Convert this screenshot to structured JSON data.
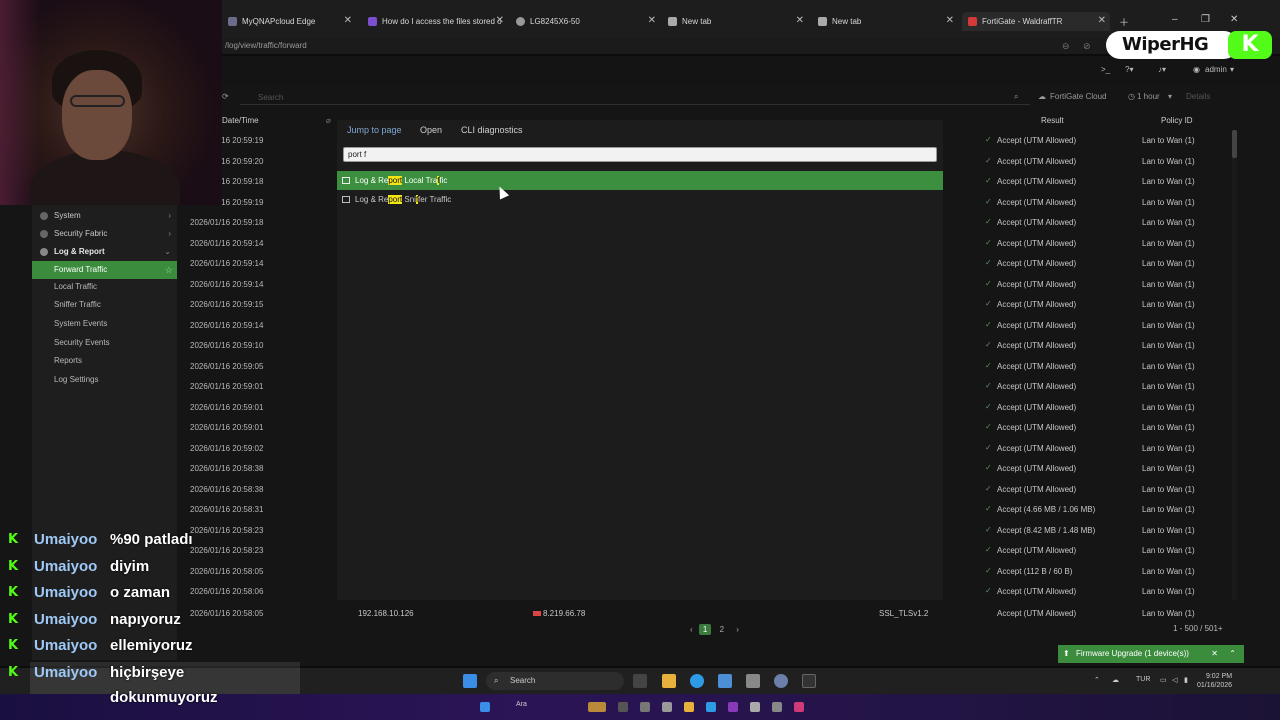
{
  "browser": {
    "tabs": [
      {
        "label": "MyQNAPcloud Edge"
      },
      {
        "label": "How do I access the files stored o"
      },
      {
        "label": "LG8245X6-50"
      },
      {
        "label": "New tab"
      },
      {
        "label": "New tab"
      },
      {
        "label": "FortiGate - WaldraffTR"
      }
    ],
    "url": "/log/view/traffic/forward"
  },
  "app": {
    "admin_label": "admin",
    "search_placeholder": "Search",
    "scope": "FortiGate Cloud",
    "time_range": "1 hour",
    "details": "Details"
  },
  "sidebar": {
    "items": [
      {
        "label": "System"
      },
      {
        "label": "Security Fabric"
      },
      {
        "label": "Log & Report"
      },
      {
        "label": "Forward Traffic"
      },
      {
        "label": "Local Traffic"
      },
      {
        "label": "Sniffer Traffic"
      },
      {
        "label": "System Events"
      },
      {
        "label": "Security Events"
      },
      {
        "label": "Reports"
      },
      {
        "label": "Log Settings"
      }
    ]
  },
  "table": {
    "headers": {
      "date": "Date/Time",
      "result": "Result",
      "policy": "Policy ID"
    },
    "rows": [
      {
        "date": "2026/01/16 20:59:19",
        "result": "Accept (UTM Allowed)",
        "policy": "Lan to Wan (1)"
      },
      {
        "date": "2026/01/16 20:59:20",
        "result": "Accept (UTM Allowed)",
        "policy": "Lan to Wan (1)"
      },
      {
        "date": "2026/01/16 20:59:18",
        "result": "Accept (UTM Allowed)",
        "policy": "Lan to Wan (1)"
      },
      {
        "date": "2026/01/16 20:59:19",
        "result": "Accept (UTM Allowed)",
        "policy": "Lan to Wan (1)"
      },
      {
        "date": "2026/01/16 20:59:18",
        "result": "Accept (UTM Allowed)",
        "policy": "Lan to Wan (1)"
      },
      {
        "date": "2026/01/16 20:59:14",
        "result": "Accept (UTM Allowed)",
        "policy": "Lan to Wan (1)"
      },
      {
        "date": "2026/01/16 20:59:14",
        "result": "Accept (UTM Allowed)",
        "policy": "Lan to Wan (1)"
      },
      {
        "date": "2026/01/16 20:59:14",
        "result": "Accept (UTM Allowed)",
        "policy": "Lan to Wan (1)"
      },
      {
        "date": "2026/01/16 20:59:15",
        "result": "Accept (UTM Allowed)",
        "policy": "Lan to Wan (1)"
      },
      {
        "date": "2026/01/16 20:59:14",
        "result": "Accept (UTM Allowed)",
        "policy": "Lan to Wan (1)"
      },
      {
        "date": "2026/01/16 20:59:10",
        "result": "Accept (UTM Allowed)",
        "policy": "Lan to Wan (1)"
      },
      {
        "date": "2026/01/16 20:59:05",
        "result": "Accept (UTM Allowed)",
        "policy": "Lan to Wan (1)"
      },
      {
        "date": "2026/01/16 20:59:01",
        "result": "Accept (UTM Allowed)",
        "policy": "Lan to Wan (1)"
      },
      {
        "date": "2026/01/16 20:59:01",
        "result": "Accept (UTM Allowed)",
        "policy": "Lan to Wan (1)"
      },
      {
        "date": "2026/01/16 20:59:01",
        "result": "Accept (UTM Allowed)",
        "policy": "Lan to Wan (1)"
      },
      {
        "date": "2026/01/16 20:59:02",
        "result": "Accept (UTM Allowed)",
        "policy": "Lan to Wan (1)"
      },
      {
        "date": "2026/01/16 20:58:38",
        "result": "Accept (UTM Allowed)",
        "policy": "Lan to Wan (1)"
      },
      {
        "date": "2026/01/16 20:58:38",
        "result": "Accept (UTM Allowed)",
        "policy": "Lan to Wan (1)"
      },
      {
        "date": "2026/01/16 20:58:31",
        "result": "Accept (4.66 MB / 1.06 MB)",
        "policy": "Lan to Wan (1)"
      },
      {
        "date": "2026/01/16 20:58:23",
        "result": "Accept (8.42 MB / 1.48 MB)",
        "policy": "Lan to Wan (1)"
      },
      {
        "date": "2026/01/16 20:58:23",
        "result": "Accept (UTM Allowed)",
        "policy": "Lan to Wan (1)"
      },
      {
        "date": "2026/01/16 20:58:05",
        "result": "Accept (112 B / 60 B)",
        "policy": "Lan to Wan (1)"
      },
      {
        "date": "2026/01/16 20:58:06",
        "result": "Accept (UTM Allowed)",
        "policy": "Lan to Wan (1)"
      }
    ],
    "last_row": {
      "date": "2026/01/16 20:58:05",
      "source": "192.168.10.126",
      "destination": "8.219.66.78",
      "service": "SSL_TLSv1.2",
      "result": "Accept (UTM Allowed)",
      "policy": "Lan to Wan (1)"
    },
    "pages": [
      "1",
      "2"
    ],
    "count": "1 - 500 / 501+"
  },
  "jump": {
    "tabs": [
      "Jump to page",
      "Open",
      "CLI diagnostics"
    ],
    "query": "port f",
    "results": [
      {
        "pre": "Log & Re",
        "hl1": "port",
        "mid": " Local Tra",
        "hl2": "f",
        "post": "fic"
      },
      {
        "pre": "Log & Re",
        "hl1": "port",
        "mid": " Sni",
        "hl2": "f",
        "post": "fer Traffic"
      }
    ]
  },
  "toast": {
    "label": "Firmware Upgrade (1 device(s))"
  },
  "taskbar": {
    "search": "Search",
    "lang": "TUR",
    "time": "9:02 PM",
    "date": "01/16/2026"
  },
  "outer": {
    "search": "Ara"
  },
  "logo": {
    "text": "WiperHG",
    "badge": "K"
  },
  "chat": [
    {
      "user": "Umaiyoo",
      "msg": "%90 patladı"
    },
    {
      "user": "Umaiyoo",
      "msg": "diyim"
    },
    {
      "user": "Umaiyoo",
      "msg": "o zaman"
    },
    {
      "user": "Umaiyoo",
      "msg": "napıyoruz"
    },
    {
      "user": "Umaiyoo",
      "msg": "ellemiyoruz"
    },
    {
      "user": "Umaiyoo",
      "msg": "hiçbirşeye"
    },
    {
      "user": "",
      "msg": "dokunmuyoruz"
    }
  ],
  "colors": {
    "accent": "#3b8c3d",
    "highlight": "#f4e516",
    "kick": "#53fc18",
    "chat_user": "#9ec8f5"
  }
}
